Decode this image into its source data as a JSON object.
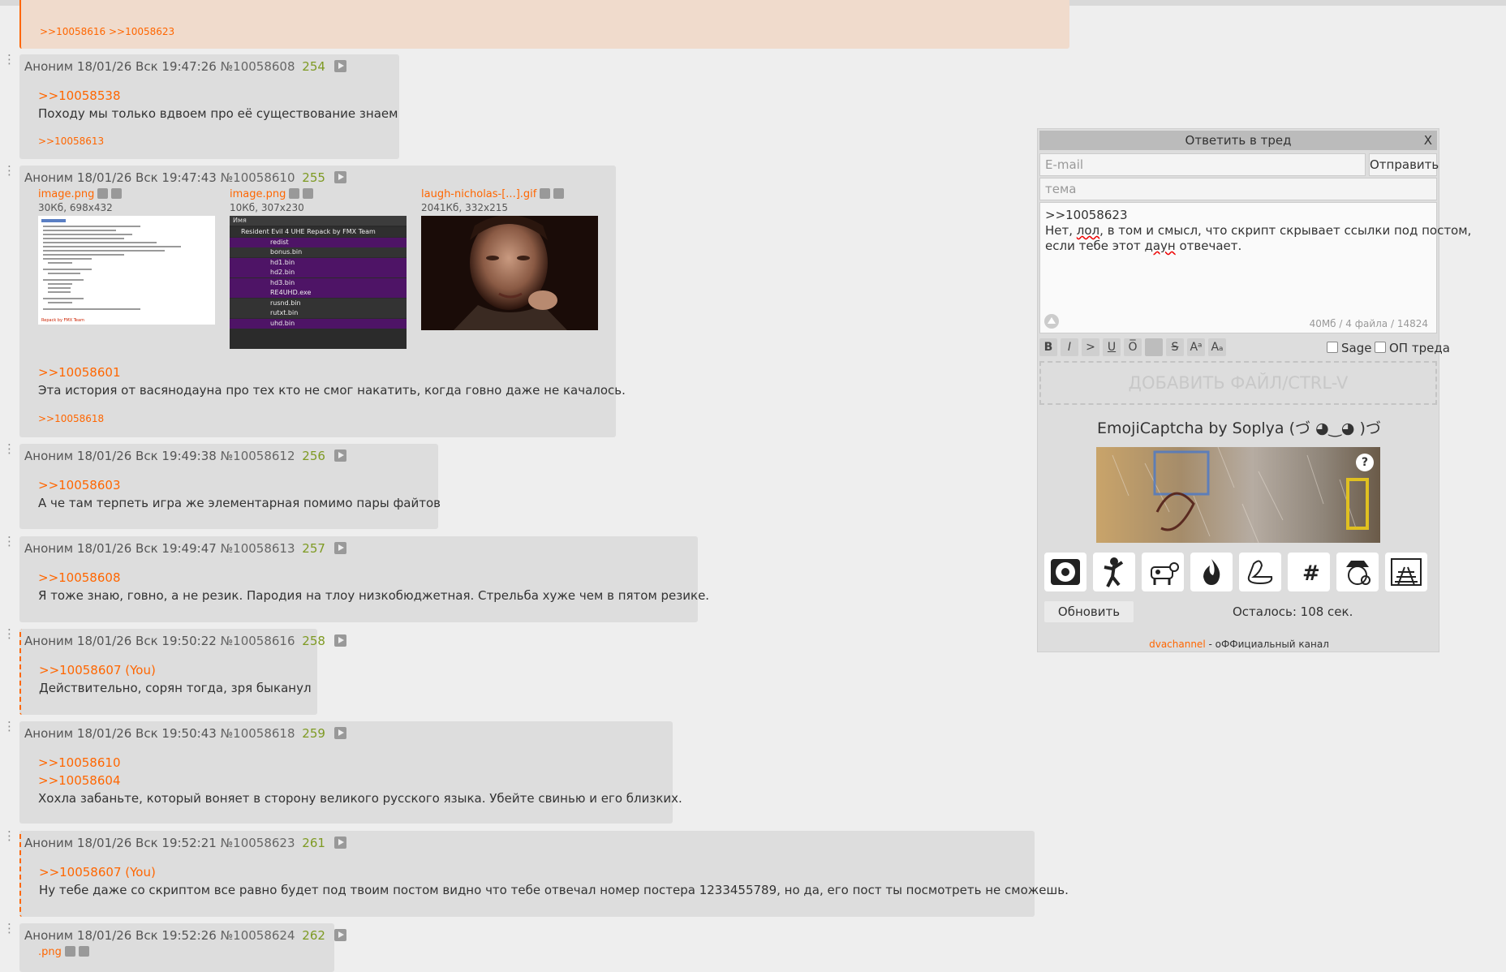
{
  "posts": [
    {
      "backlinks": ">>10058616 >>10058623"
    },
    {
      "head": {
        "name": "Аноним",
        "date": "18/01/26 Вск 19:47:26",
        "num": "№10058608",
        "count": "254"
      },
      "reply": ">>10058538",
      "text": "Походу мы только вдвоем про её существование знаем",
      "backlinks": ">>10058613"
    },
    {
      "head": {
        "name": "Аноним",
        "date": "18/01/26 Вск 19:47:43",
        "num": "№10058610",
        "count": "255"
      },
      "files": [
        {
          "name": "image.png",
          "meta": "30Кб, 698x432"
        },
        {
          "name": "image.png",
          "meta": "10Кб, 307x230"
        },
        {
          "name": "laugh-nicholas-[...].gif",
          "meta": "2041Кб, 332x215"
        }
      ],
      "reply": ">>10058601",
      "text": "Эта история от васянодауна про тех кто не смог накатить, когда говно даже не качалось.",
      "backlinks": ">>10058618"
    },
    {
      "head": {
        "name": "Аноним",
        "date": "18/01/26 Вск 19:49:38",
        "num": "№10058612",
        "count": "256"
      },
      "reply": ">>10058603",
      "text": "А че там терпеть игра же элементарная помимо пары файтов"
    },
    {
      "head": {
        "name": "Аноним",
        "date": "18/01/26 Вск 19:49:47",
        "num": "№10058613",
        "count": "257"
      },
      "reply": ">>10058608",
      "text": "Я тоже знаю, говно, а не резик. Пародия на тлоу низкобюджетная. Стрельба хуже чем в пятом резике."
    },
    {
      "head": {
        "name": "Аноним",
        "date": "18/01/26 Вск 19:50:22",
        "num": "№10058616",
        "count": "258"
      },
      "reply": ">>10058607 (You)",
      "text": "Действительно, сорян тогда, зря быканул"
    },
    {
      "head": {
        "name": "Аноним",
        "date": "18/01/26 Вск 19:50:43",
        "num": "№10058618",
        "count": "259"
      },
      "reply": ">>10058610",
      "reply2": ">>10058604",
      "text": "Хохла забаньте, который воняет в сторону великого русского языка. Убейте свинью и его близких."
    },
    {
      "head": {
        "name": "Аноним",
        "date": "18/01/26 Вск 19:52:21",
        "num": "№10058623",
        "count": "261"
      },
      "reply": ">>10058607 (You)",
      "text": "Ну тебе даже со скриптом все равно будет под твоим постом видно что тебе отвечал номер постера 1233455789, но да, его пост ты посмотреть не сможешь."
    },
    {
      "head": {
        "name": "Аноним",
        "date": "18/01/26 Вск 19:52:26",
        "num": "№10058624",
        "count": "262"
      },
      "file": ".png"
    }
  ],
  "thumb2": {
    "title": "Имя",
    "rows": [
      "Resident Evil 4 UHE Repack by FMX Team",
      "redist",
      "bonus.bin",
      "hd1.bin",
      "hd2.bin",
      "hd3.bin",
      "RE4UHD.exe",
      "rusnd.bin",
      "rutxt.bin",
      "uhd.bin"
    ]
  },
  "thumb1": {
    "footer": "Repack by FMX Team"
  },
  "form": {
    "title": "Ответить в тред",
    "close": "X",
    "email_placeholder": "E-mail",
    "send": "Отправить",
    "subject_placeholder": "тема",
    "text_line1": ">>10058623",
    "text_line2": "Нет, лол, в том и смысл, что скрипт скрывает ссылки под постом,",
    "text_line3": "если тебе этот даун отвечает.",
    "limits": "40Мб / 4 файла / 14824",
    "toolbar": [
      "B",
      "I",
      ">",
      "U",
      "O̅",
      "",
      "S",
      "Aᵃ",
      "Aₐ"
    ],
    "sage": "Sage",
    "op": "ОП треда",
    "dropzone": "ДОБАВИТЬ ФАЙЛ/CTRL-V",
    "captcha_title": "EmojiCaptcha by Soplya (づ ◕‿◕ )づ",
    "captcha_help": "?",
    "emojis": [
      "vinyl-icon",
      "dancer-icon",
      "cow-icon",
      "fire-icon",
      "swan-icon",
      "hash-icon",
      "detective-icon",
      "railway-icon"
    ],
    "hash_glyph": "#",
    "refresh": "Обновить",
    "remaining": "Осталось: 108 сек.",
    "footer_link": "dvachannel",
    "footer_text": " - оФФициальный канал"
  },
  "colors": {
    "accent": "#ff6600",
    "count": "#7e9a23",
    "post_bg": "#dddddd",
    "highlight_bg": "#f0dbcc"
  }
}
